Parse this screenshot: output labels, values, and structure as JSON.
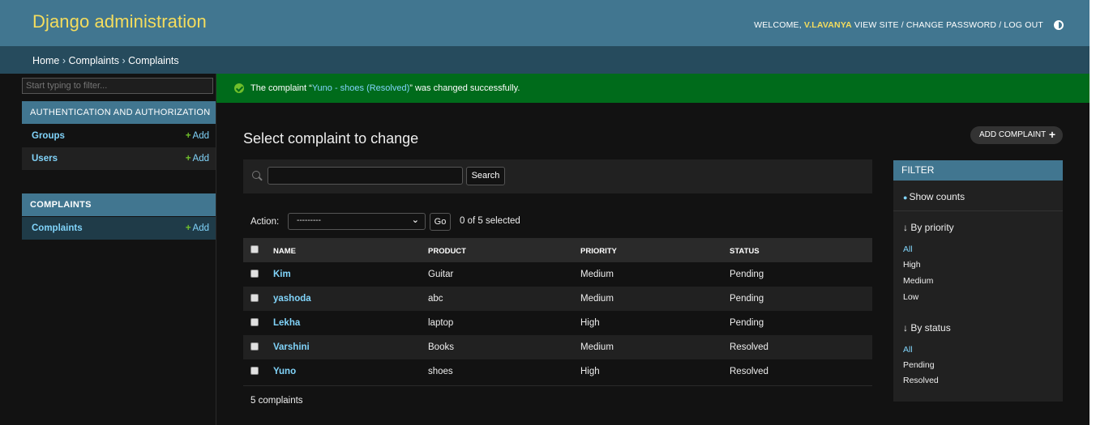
{
  "header": {
    "branding": "Django administration",
    "welcome": "WELCOME,",
    "username": "V.LAVANYA",
    "view_site": "VIEW SITE",
    "sep1": "/",
    "change_password": "CHANGE PASSWORD",
    "sep2": "/",
    "logout": "LOG OUT"
  },
  "breadcrumbs": {
    "home": "Home",
    "sep1": " › ",
    "app": "Complaints",
    "sep2": " › ",
    "current": "Complaints"
  },
  "sidebar": {
    "filter_placeholder": "Start typing to filter...",
    "apps": [
      {
        "caption": "AUTHENTICATION AND AUTHORIZATION",
        "models": [
          {
            "name": "Groups",
            "add": "Add"
          },
          {
            "name": "Users",
            "add": "Add"
          }
        ]
      },
      {
        "caption": "COMPLAINTS",
        "models": [
          {
            "name": "Complaints",
            "add": "Add"
          }
        ]
      }
    ],
    "toggle": "«"
  },
  "message": {
    "before": "The complaint “",
    "link": "Yuno - shoes (Resolved)",
    "after": "” was changed successfully."
  },
  "main": {
    "title": "Select complaint to change",
    "add_button": "ADD COMPLAINT",
    "search_button": "Search",
    "action_label": "Action:",
    "action_value": "---------",
    "go_button": "Go",
    "selected_count": "0 of 5 selected",
    "columns": [
      "NAME",
      "PRODUCT",
      "PRIORITY",
      "STATUS"
    ],
    "rows": [
      {
        "name": "Kim",
        "product": "Guitar",
        "priority": "Medium",
        "status": "Pending"
      },
      {
        "name": "yashoda",
        "product": "abc",
        "priority": "Medium",
        "status": "Pending"
      },
      {
        "name": "Lekha",
        "product": "laptop",
        "priority": "High",
        "status": "Pending"
      },
      {
        "name": "Varshini",
        "product": "Books",
        "priority": "Medium",
        "status": "Resolved"
      },
      {
        "name": "Yuno",
        "product": "shoes",
        "priority": "High",
        "status": "Resolved"
      }
    ],
    "paginator": "5 complaints"
  },
  "filter": {
    "title": "FILTER",
    "show_counts": "Show counts",
    "by_priority": "↓ By priority",
    "priority_options": [
      "All",
      "High",
      "Medium",
      "Low"
    ],
    "by_status": "↓ By status",
    "status_options": [
      "All",
      "Pending",
      "Resolved"
    ]
  },
  "colors": {
    "header": "#417690",
    "breadcrumbs": "#264b5d",
    "branding": "#f5dd5d",
    "link": "#81d4fa",
    "success": "#006b1b",
    "add_plus": "#70bf2b"
  }
}
